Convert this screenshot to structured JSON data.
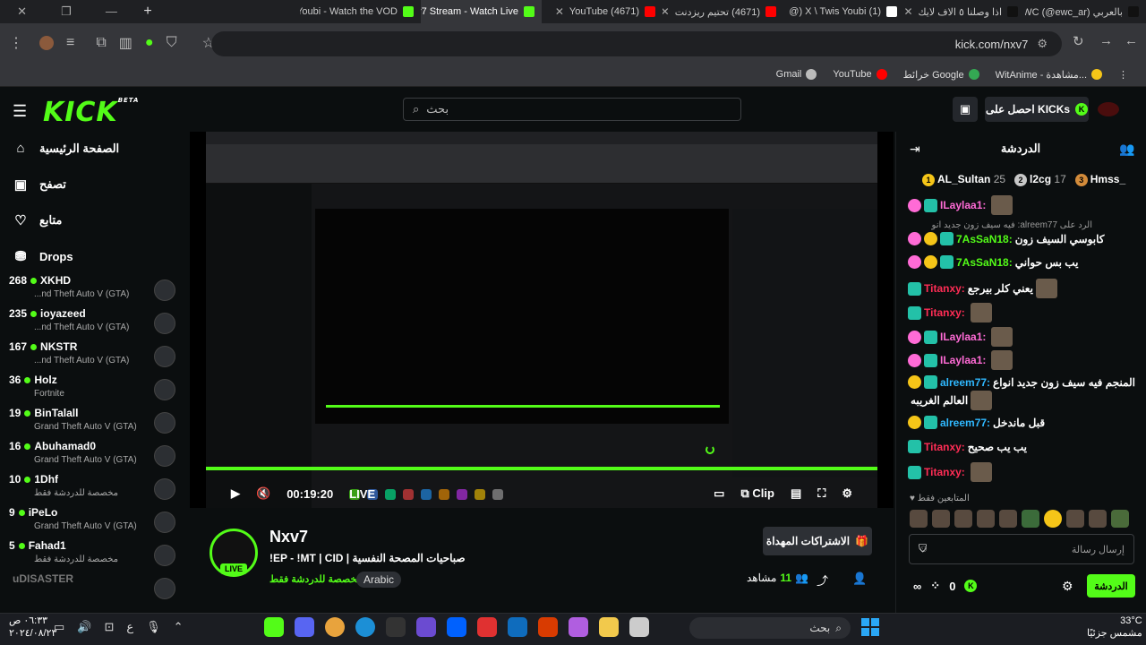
{
  "browser": {
    "tabs": [
      {
        "title": "Youbi - Watch the VOD",
        "color": "#53fc18",
        "active": false
      },
      {
        "title": "Nxv7 Stream - Watch Live",
        "color": "#53fc18",
        "active": true
      },
      {
        "title": "(4671) YouTube",
        "color": "#ff0000",
        "active": false
      },
      {
        "title": "(4671) تحتيم ريزدنت",
        "color": "#ff0000",
        "active": false
      },
      {
        "title": "(1) X \\ Twis Youbi (@",
        "color": "#ffffff",
        "active": false
      },
      {
        "title": "اذا وصلنا ٥ الاف لايك",
        "color": "#111111",
        "active": false
      },
      {
        "title": "بالعربي EWC (@ewc_ar)",
        "color": "#111111",
        "active": false
      }
    ],
    "url": "kick.com/nxv7",
    "bookmarks": [
      {
        "label": "Gmail",
        "color": "#bbbbbb"
      },
      {
        "label": "YouTube",
        "color": "#ff0000"
      },
      {
        "label": "خرائط Google",
        "color": "#34a853"
      },
      {
        "label": "WitAnime - مشاهدة...",
        "color": "#f5c518"
      }
    ]
  },
  "header": {
    "logo": "KICK",
    "logo_beta": "BETA",
    "search_placeholder": "بحث",
    "get_kicks": "احصل على KICKs"
  },
  "sidebar": {
    "nav": [
      {
        "label": "الصفحة الرئيسية",
        "icon": "home-icon"
      },
      {
        "label": "تصفح",
        "icon": "browse-icon"
      },
      {
        "label": "متابع",
        "icon": "heart-icon"
      },
      {
        "label": "Drops",
        "icon": "drops-icon"
      }
    ],
    "channels": [
      {
        "viewers": "268",
        "name": "XKHD",
        "category": "...nd Theft Auto V (GTA)"
      },
      {
        "viewers": "235",
        "name": "ioyazeed",
        "category": "...nd Theft Auto V (GTA)"
      },
      {
        "viewers": "167",
        "name": "NKSTR",
        "category": "...nd Theft Auto V (GTA)"
      },
      {
        "viewers": "36",
        "name": "Holz",
        "category": "Fortnite"
      },
      {
        "viewers": "19",
        "name": "BinTalall",
        "category": "Grand Theft Auto V (GTA)"
      },
      {
        "viewers": "16",
        "name": "Abuhamad0",
        "category": "Grand Theft Auto V (GTA)"
      },
      {
        "viewers": "10",
        "name": "1Dhf",
        "category": "مخصصة للدردشة فقط"
      },
      {
        "viewers": "9",
        "name": "iPeLo",
        "category": "Grand Theft Auto V (GTA)"
      },
      {
        "viewers": "5",
        "name": "Fahad1",
        "category": "مخصصة للدردشة فقط"
      },
      {
        "viewers": "",
        "name": "uDISASTER",
        "category": ""
      }
    ]
  },
  "player": {
    "time": "00:19:20",
    "live_label": "LIVE",
    "clip_label": "Clip"
  },
  "stream": {
    "name": "Nxv7",
    "title": "!EP - !MT | CID | صباحيات المصحة النفسية",
    "category": "مخصصة للدردشة فقط",
    "tag": "Arabic",
    "gift_label": "الاشتراكات المهداة",
    "viewers": "11",
    "viewers_label": "مشاهد",
    "live_badge": "LIVE"
  },
  "chat": {
    "title": "الدردشة",
    "leaders": [
      {
        "rank": "1",
        "name": "AL_Sultan",
        "count": "25",
        "color": "#f5c518"
      },
      {
        "rank": "2",
        "name": "l2cg",
        "count": "17",
        "color": "#c8c8c8"
      },
      {
        "rank": "3",
        "name": "Hmss_",
        "count": "",
        "color": "#d38b3a"
      }
    ],
    "reply_preview": "الرد على alreem77: فيه سيف زون جديد انو...",
    "messages": [
      {
        "user": "ILaylaa1:",
        "color": "#ff6bd6",
        "text": "",
        "badge": "#ff6bd6",
        "sub": false,
        "emote": true
      },
      {
        "user": "7AsSaN18:",
        "color": "#53fc18",
        "text": "كابوسي السيف زون",
        "badge": "#ff6bd6",
        "sub": true,
        "emote": false
      },
      {
        "user": "7AsSaN18:",
        "color": "#53fc18",
        "text": "يب بس حواني",
        "badge": "#ff6bd6",
        "sub": true,
        "emote": false
      },
      {
        "user": "Titanxy:",
        "color": "#ff2d55",
        "text": "يعني كلر بيرجع",
        "badge": "",
        "sub": false,
        "emote": true
      },
      {
        "user": "Titanxy:",
        "color": "#ff2d55",
        "text": "",
        "badge": "",
        "sub": false,
        "emote": true
      },
      {
        "user": "ILaylaa1:",
        "color": "#ff6bd6",
        "text": "",
        "badge": "#ff6bd6",
        "sub": false,
        "emote": true
      },
      {
        "user": "ILaylaa1:",
        "color": "#ff6bd6",
        "text": "",
        "badge": "#ff6bd6",
        "sub": false,
        "emote": true
      },
      {
        "user": "alreem77:",
        "color": "#2fb8ff",
        "text": "المنجم فيه سيف زون جديد انواع",
        "badge": "#f5c518",
        "sub": false,
        "emote": false
      },
      {
        "user": "",
        "color": "#fff",
        "text": "العالم الغريبه",
        "badge": "",
        "sub": false,
        "emote": true
      },
      {
        "user": "alreem77:",
        "color": "#2fb8ff",
        "text": "قبل ماندخل",
        "badge": "#f5c518",
        "sub": false,
        "emote": false
      },
      {
        "user": "Titanxy:",
        "color": "#ff2d55",
        "text": "يب يب صحيح",
        "badge": "",
        "sub": false,
        "emote": false
      },
      {
        "user": "Titanxy:",
        "color": "#ff2d55",
        "text": "",
        "badge": "",
        "sub": false,
        "emote": true
      }
    ],
    "subs_only": "المتابعين فقط",
    "input_placeholder": "إرسال رسالة",
    "send_label": "الدردشة",
    "points": "0"
  },
  "taskbar": {
    "search": "بحث",
    "temp": "33°C",
    "weather": "مشمس جزئيًا",
    "time": "٠٦:٣٣ ص",
    "date": "٢٠٢٤/٠٨/٢٣",
    "lang": "ع"
  }
}
